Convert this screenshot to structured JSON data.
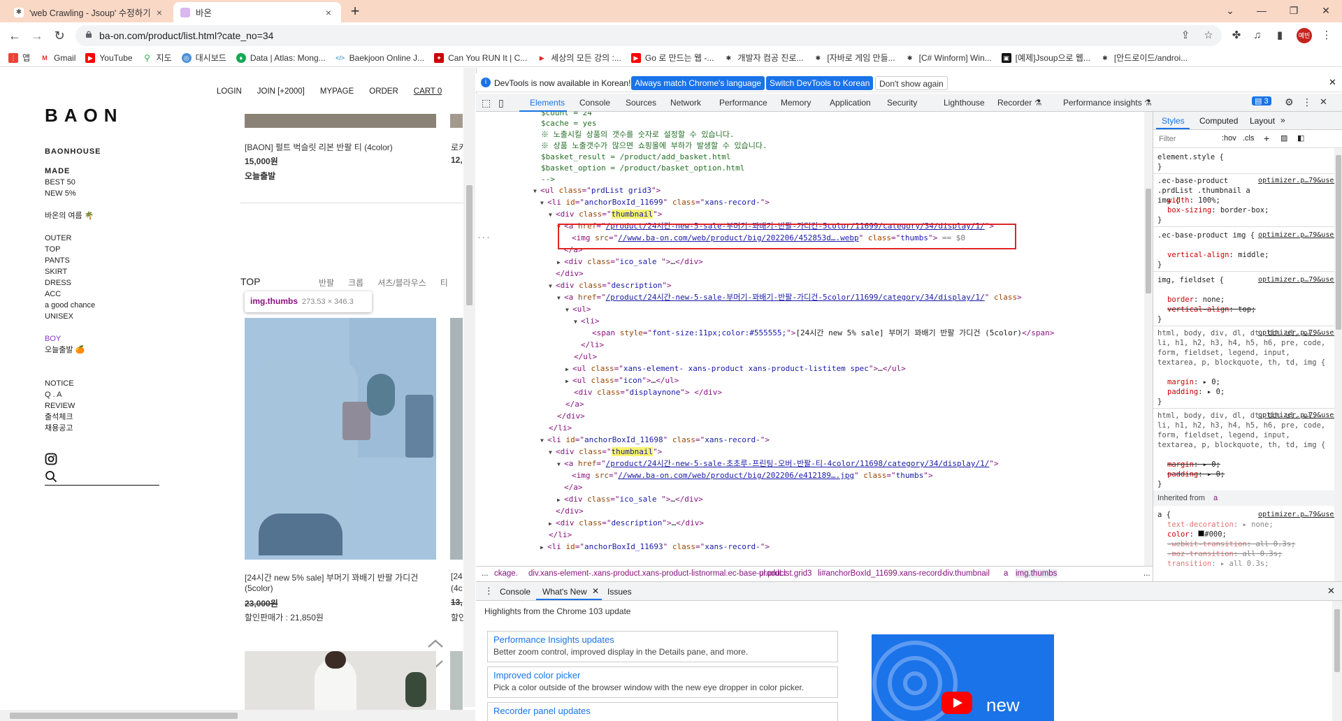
{
  "browser": {
    "tabs": [
      {
        "title": "'web Crawling - Jsoup' 수정하기",
        "close": "×"
      },
      {
        "title": "바온",
        "close": "×"
      }
    ],
    "new_tab": "+",
    "url": "ba-on.com/product/list.html?cate_no=34",
    "avatar": "예빈",
    "bookmarks": [
      "앱",
      "Gmail",
      "YouTube",
      "지도",
      "대시보드",
      "Data | Atlas: Mong...",
      "Baekjoon Online J...",
      "Can You RUN It | C...",
      "세상의 모든 강의 :...",
      "Go 로 만드는 웹 -...",
      "개발자 컴공 진로...",
      "[자바로 게임 만들...",
      "[C# Winform] Win...",
      "[예제]Jsoup으로 웹...",
      "[안드로이드/androi..."
    ]
  },
  "page": {
    "brand": "BAON",
    "topnav": [
      "LOGIN",
      "JOIN [+2000]",
      "MYPAGE",
      "ORDER",
      "CART 0"
    ],
    "nav_baonhouse": "BAONHOUSE",
    "nav_made": "MADE",
    "nav_best": "BEST 50",
    "nav_new": "NEW 5%",
    "nav_summer": "바온의 여름 🌴",
    "nav_cats": [
      "OUTER",
      "TOP",
      "PANTS",
      "SKIRT",
      "DRESS",
      "ACC",
      "a good chance",
      "UNISEX"
    ],
    "nav_boy": "BOY",
    "nav_today": "오늘출발 🍊",
    "nav_info": [
      "NOTICE",
      "Q . A",
      "REVIEW",
      "출석체크",
      "채용공고"
    ],
    "prod_top": {
      "name": "[BAON] 펄트 벅슬릿 리본 반팔 티 (4color)",
      "price": "15,000원",
      "badge": "오늘출발",
      "side_name": "로키",
      "side_price": "12,"
    },
    "category_title": "TOP",
    "category_tabs": [
      "반팔",
      "크롭",
      "셔츠/블라우스",
      "티"
    ],
    "tooltip_tag": "img.thumbs",
    "tooltip_dim": "273.53 × 346.3",
    "prod_main": {
      "name": "[24시간 new 5% sale] 부머기 꽈배기 반팔 가디건",
      "name2": "(5color)",
      "old_price": "23,000원",
      "sale_price": "할인판매가 : 21,850원",
      "side_name": "[24",
      "side_name2": "(4c",
      "side_old": "13,",
      "side_sale": "할인"
    }
  },
  "devtools": {
    "info": "DevTools is now available in Korean!",
    "btn_match": "Always match Chrome's language",
    "btn_switch": "Switch DevTools to Korean",
    "btn_dont": "Don't show again",
    "tabs": [
      "Elements",
      "Console",
      "Sources",
      "Network",
      "Performance",
      "Memory",
      "Application",
      "Security",
      "Lighthouse",
      "Recorder ⚗",
      "Performance insights ⚗"
    ],
    "issues_badge": "3",
    "code": {
      "l0": "$count = 24",
      "l1": "$cache = yes",
      "l2": "※ 노출시킬 상품의 갯수를 숫자로 설정할 수 있습니다.",
      "l3": "※ 상품 노출갯수가 많으면 쇼핑몰에 부하가 발생할 수 있습니다.",
      "l4": "$basket_result = /product/add_basket.html",
      "l5": "$basket_option = /product/basket_option.html",
      "l6": "-->",
      "ul_class": "prdList grid3",
      "li1_id": "anchorBoxId_11699",
      "li_class": "xans-record-",
      "div_thumb": "thumbnail",
      "href1": "/product/24시간-new-5-sale-부머기-꽈배기-반팔-가디건-5color/11699/category/34/display/1/",
      "img1": "//www.ba-on.com/web/product/big/202206/452853d….webp",
      "img_class": "thumbs",
      "eq": "== $0",
      "ico_sale": "ico_sale  ",
      "desc": "description",
      "span_style": "font-size:11px;color:#555555;",
      "span_text": "[24시간 new 5% sale] 부머기 꽈배기 반팔 가디건 (5color)",
      "ul_spec": "xans-element- xans-product xans-product-listitem spec",
      "ul_icon": "icon",
      "div_none": "displaynone",
      "li2_id": "anchorBoxId_11698",
      "href2": "/product/24시간-new-5-sale-초초루-프린팅-오버-반팔-티-4color/11698/category/34/display/1/",
      "img2": "//www.ba-on.com/web/product/big/202206/e412189….jpg",
      "li3_id": "anchorBoxId_11693"
    },
    "breadcrumbs": [
      "...",
      "ckage.",
      "div.xans-element-.xans-product.xans-product-listnormal.ec-base-product",
      "ul.prdList.grid3",
      "li#anchorBoxId_11699.xans-record-",
      "div.thumbnail",
      "a",
      "img.thumbs",
      "..."
    ],
    "styles_tabs": [
      "Styles",
      "Computed",
      "Layout"
    ],
    "filter": "Filter",
    "hov": ":hov",
    ".cls": ".cls",
    "styles": {
      "element_style": "element.style {",
      "r1_sel": ".ec-base-product .prdList .thumbnail a img {",
      "r1_src": "optimizer.p…79&user=T:1",
      "r1_p1": "width",
      "r1_v1": "100%;",
      "r1_p2": "box-sizing",
      "r1_v2": "border-box;",
      "r2_sel": ".ec-base-product img {",
      "r2_p1": "vertical-align",
      "r2_v1": "middle;",
      "r3_sel": "img, fieldset {",
      "r3_p1": "border",
      "r3_v1": "none;",
      "r3_p2": "vertical-align",
      "r3_v2": "top;",
      "r4_sel": "html, body, div, dl, dt, dd, ul, ol, li, h1, h2, h3, h4, h5, h6, pre, code, form, fieldset, legend, input, textarea, p, blockquote, th, td, img {",
      "r4_p1": "margin",
      "r4_v1": "0;",
      "r4_p2": "padding",
      "r4_v2": "0;",
      "inherited": "Inherited from",
      "inh_tag": "a",
      "r6_sel": "a {",
      "r6_p1": "text-decoration",
      "r6_v1": "none;",
      "r6_p2": "color",
      "r6_v2": "#000;",
      "r6_p3": "-webkit-transition",
      "r6_v3": "all 0.3s;",
      "r6_p4": "-moz-transition",
      "r6_v4": "all 0.3s;",
      "r6_p5": "transition",
      "r6_v5": "all 0.3s;"
    },
    "drawer_tabs": [
      "Console",
      "What's New",
      "Issues"
    ],
    "highlights": "Highlights from the Chrome 103 update",
    "cards": [
      {
        "title": "Performance Insights updates",
        "desc": "Better zoom control, improved display in the Details pane, and more."
      },
      {
        "title": "Improved color picker",
        "desc": "Pick a color outside of the browser window with the new eye dropper in color picker."
      },
      {
        "title": "Recorder panel updates",
        "desc": ""
      }
    ],
    "promo_text": "new"
  }
}
